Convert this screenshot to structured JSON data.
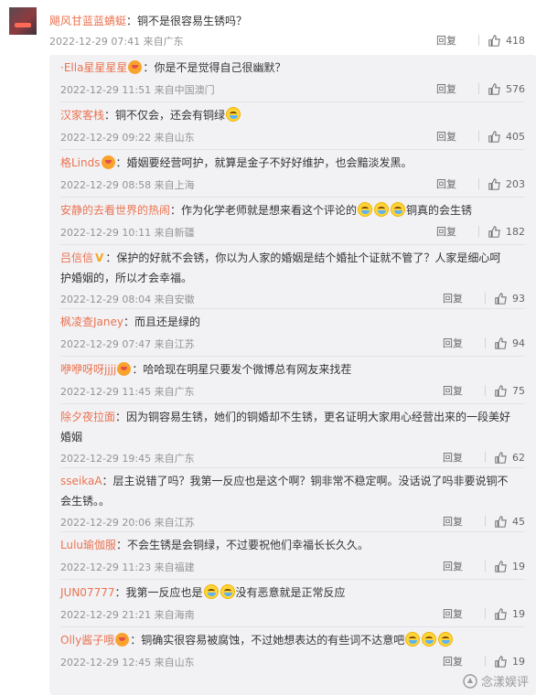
{
  "top_comment": {
    "user": "飓风甘蓝蓝蜻蜓",
    "text": "铜不是很容易生锈吗？",
    "time": "2022-12-29 07:41",
    "location": "来自广东",
    "reply_label": "回复",
    "likes": "418"
  },
  "replies": [
    {
      "user": "·Ella星星星星",
      "badge": true,
      "line1": "你是不是觉得自己很幽默？",
      "line2": "",
      "time": "2022-12-29 11:51",
      "location": "来自中国澳门",
      "likes": "576"
    },
    {
      "user": "汉家客栈",
      "line1": "铜不仅会，还会有铜绿",
      "emoji_after": 1,
      "line2": "",
      "time": "2022-12-29 09:22",
      "location": "来自山东",
      "likes": "405"
    },
    {
      "user": "格Linds",
      "badge": true,
      "line1": "婚姻要经营呵护，就算是金子不好好维护，也会黯淡发黑。",
      "line2": "",
      "time": "2022-12-29 08:58",
      "location": "来自上海",
      "likes": "203"
    },
    {
      "user": "安静的去看世界的热闹",
      "line1": "作为化学老师就是想来看这个评论的",
      "emoji_mid": 3,
      "line1b": "铜真的会生锈",
      "line2": "",
      "time": "2022-12-29 10:11",
      "location": "来自新疆",
      "likes": "182"
    },
    {
      "user": "吕信信",
      "vbadge": "V",
      "line1": "保护的好就不会锈，你以为人家的婚姻是结个婚扯个证就不管了？人家是细心呵",
      "line2": "护婚姻的，所以才会幸福。",
      "time": "2022-12-29 08:04",
      "location": "来自安徽",
      "likes": "93"
    },
    {
      "user": "枫凌查Janey",
      "line1": "而且还是绿的",
      "line2": "",
      "time": "2022-12-29 07:47",
      "location": "来自江苏",
      "likes": "94"
    },
    {
      "user": "咿咿呀呀jjjj",
      "badge": true,
      "line1": "哈哈现在明星只要发个微博总有网友来找茬",
      "line2": "",
      "time": "2022-12-29 11:45",
      "location": "来自广东",
      "likes": "75"
    },
    {
      "user": "除夕夜拉面",
      "line1": "因为铜容易生锈，她们的铜婚却不生锈，更名证明大家用心经营出来的一段美好",
      "line2": "婚姻",
      "time": "2022-12-29 19:45",
      "location": "来自广东",
      "likes": "62"
    },
    {
      "user": "sseikaA",
      "line1": "层主说错了吗？我第一反应也是这个啊？铜非常不稳定啊。没话说了吗非要说铜不",
      "line2": "会生锈。。",
      "time": "2022-12-29 20:06",
      "location": "来自江苏",
      "likes": "45"
    },
    {
      "user": "Lulu瑜伽服",
      "line1": "不会生锈是会铜绿，不过要祝他们幸福长长久久。",
      "line2": "",
      "time": "2022-12-29 11:23",
      "location": "来自福建",
      "likes": "19"
    },
    {
      "user": "JUN07777",
      "line1": "我第一反应也是",
      "emoji_mid": 2,
      "line1b": "没有恶意就是正常反应",
      "line2": "",
      "time": "2022-12-29 21:21",
      "location": "来自海南",
      "likes": "19"
    },
    {
      "user": "Olly酱子哦",
      "badge": true,
      "line1": "铜确实很容易被腐蚀，不过她想表达的有些词不达意吧",
      "emoji_after": 3,
      "line2": "",
      "time": "2022-12-29 12:45",
      "location": "来自山东",
      "likes": "19"
    }
  ],
  "reply_label": "回复",
  "watermark": "念漾娱评",
  "colors": {
    "username": "#eb7350",
    "panel": "#f2f2f5",
    "meta": "#939393"
  }
}
